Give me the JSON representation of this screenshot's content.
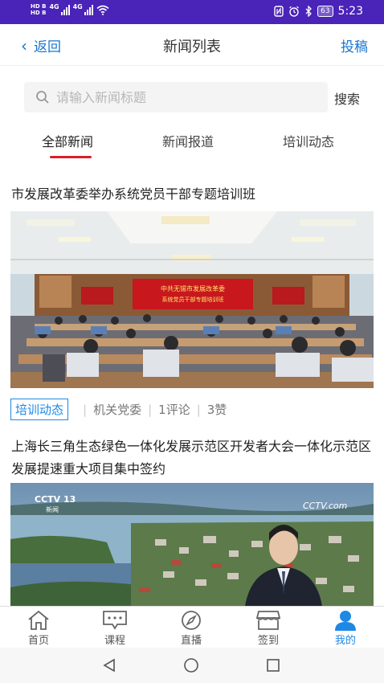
{
  "status_bar": {
    "sim1": "HD B",
    "sim2": "HD B",
    "net1": "4G",
    "net2": "4G",
    "battery": "63",
    "time": "5:23"
  },
  "nav": {
    "back_label": "返回",
    "title": "新闻列表",
    "submit_label": "投稿"
  },
  "search": {
    "placeholder": "请输入新闻标题",
    "button_label": "搜索"
  },
  "tabs": [
    {
      "label": "全部新闻",
      "active": true
    },
    {
      "label": "新闻报道",
      "active": false
    },
    {
      "label": "培训动态",
      "active": false
    }
  ],
  "articles": [
    {
      "title": "市发展改革委举办系统党员干部专题培训班",
      "banner": "中共无锡市发展改革委系统党员干部专题培训班",
      "tag": "培训动态",
      "department": "机关党委",
      "comments": "1评论",
      "likes": "3赞"
    },
    {
      "title": "上海长三角生态绿色一体化发展示范区开发者大会一体化示范区发展提速重大项目集中签约",
      "logo_left": "CCTV 13",
      "logo_left_sub": "新闻",
      "logo_right": "CCTV.com"
    }
  ],
  "bottom_nav": [
    {
      "label": "首页",
      "icon": "home-icon",
      "active": false
    },
    {
      "label": "课程",
      "icon": "chat-icon",
      "active": false
    },
    {
      "label": "直播",
      "icon": "compass-icon",
      "active": false
    },
    {
      "label": "签到",
      "icon": "store-icon",
      "active": false
    },
    {
      "label": "我的",
      "icon": "user-icon",
      "active": true
    }
  ],
  "colors": {
    "status_bar": "#4a23b8",
    "accent": "#1e88e5",
    "tab_indicator": "#d81e2c"
  }
}
